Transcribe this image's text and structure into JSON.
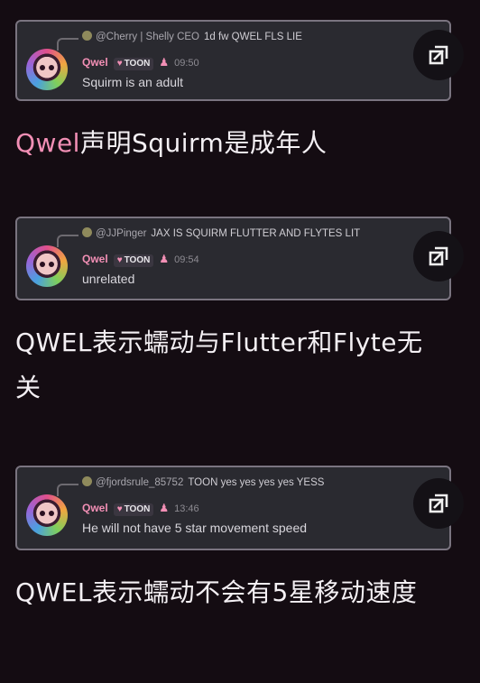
{
  "entries": [
    {
      "reply_user": "@Cherry | Shelly CEO",
      "reply_text": "1d fw  QWEL FLS LIE",
      "username": "Qwel",
      "tag": "TOON",
      "time": "09:50",
      "message": "Squirm is an adult",
      "caption_highlight": "Qwel",
      "caption_rest": "声明Squirm是成年人"
    },
    {
      "reply_user": "@JJPinger",
      "reply_text": "JAX  IS SQUIRM FLUTTER AND FLYTES LIT",
      "username": "Qwel",
      "tag": "TOON",
      "time": "09:54",
      "message": "unrelated",
      "caption_highlight": "",
      "caption_rest": "QWEL表示蠕动与Flutter和Flyte无关"
    },
    {
      "reply_user": "@fjordsrule_85752",
      "reply_text": "TOON  yes yes yes yes YESS",
      "username": "Qwel",
      "tag": "TOON",
      "time": "13:46",
      "message": "He will not have 5 star movement speed",
      "caption_highlight": "",
      "caption_rest": "QWEL表示蠕动不会有5星移动速度"
    }
  ],
  "icons": {
    "expand": "expand-icon",
    "heart": "heart-icon",
    "role": "squid-role-icon"
  },
  "colors": {
    "background": "#140c12",
    "accent_pink": "#f28fb5",
    "card": "#2a2a30"
  }
}
